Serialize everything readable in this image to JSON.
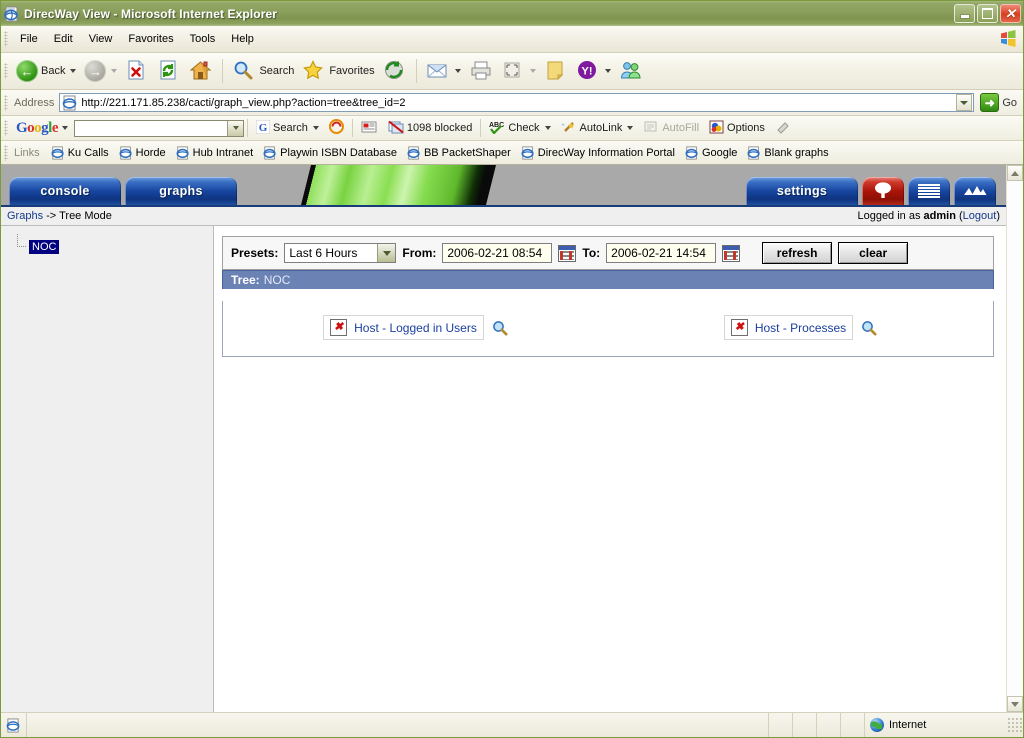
{
  "window": {
    "title": "DirecWay View - Microsoft Internet Explorer",
    "icon": "ie-document-icon",
    "minimize_label": "Minimize",
    "restore_label": "Restore",
    "close_label": "Close"
  },
  "menubar": {
    "items": [
      {
        "label": "File",
        "accel": "F"
      },
      {
        "label": "Edit",
        "accel": "E"
      },
      {
        "label": "View",
        "accel": "V"
      },
      {
        "label": "Favorites",
        "accel": "a"
      },
      {
        "label": "Tools",
        "accel": "T"
      },
      {
        "label": "Help",
        "accel": "H"
      }
    ]
  },
  "toolbar": {
    "back_label": "Back",
    "back_icon": "back-arrow-icon",
    "forward_icon": "forward-arrow-icon",
    "stop_icon": "stop-icon",
    "refresh_icon": "refresh-icon",
    "home_icon": "home-icon",
    "search_label": "Search",
    "search_icon": "magnifier-icon",
    "favorites_label": "Favorites",
    "favorites_icon": "star-icon",
    "history_icon": "history-icon",
    "mail_icon": "mail-icon",
    "print_icon": "printer-icon",
    "edit_icon": "edit-page-icon",
    "discuss_icon": "notes-icon",
    "yahoo_icon": "yahoo-icon",
    "messenger_icon": "messenger-icon"
  },
  "address": {
    "label": "Address",
    "url": "http://221.171.85.238/cacti/graph_view.php?action=tree&tree_id=2",
    "favicon": "ie-page-icon",
    "go_label": "Go",
    "go_icon": "go-arrow-icon"
  },
  "google_toolbar": {
    "brand": "Google",
    "search_value": "",
    "search_label": "Search",
    "search_icon": "google-g-icon",
    "highlight_icon": "highlight-icon",
    "news_icon": "news-icon",
    "popup_icon": "popup-blocker-icon",
    "blocked_label": "1098 blocked",
    "check_label": "Check",
    "check_icon": "spellcheck-icon",
    "autolink_label": "AutoLink",
    "autolink_icon": "autolink-wand-icon",
    "autofill_label": "AutoFill",
    "autofill_icon": "autofill-icon",
    "options_label": "Options",
    "options_icon": "options-icon",
    "eraser_icon": "eraser-icon"
  },
  "links_bar": {
    "label": "Links",
    "items": [
      {
        "label": "Ku Calls"
      },
      {
        "label": "Horde"
      },
      {
        "label": "Hub Intranet"
      },
      {
        "label": "Playwin ISBN Database"
      },
      {
        "label": "BB  PacketShaper"
      },
      {
        "label": "DirecWay Information Portal"
      },
      {
        "label": "Google"
      },
      {
        "label": "Blank graphs"
      }
    ]
  },
  "cacti": {
    "tabs": [
      {
        "label": "console",
        "name": "tab-console",
        "type": "text"
      },
      {
        "label": "graphs",
        "name": "tab-graphs",
        "type": "text"
      }
    ],
    "right_tabs": [
      {
        "label": "settings",
        "name": "tab-settings",
        "type": "text",
        "color": "#16449e"
      },
      {
        "label": "",
        "name": "tab-tree-view",
        "type": "tree-icon",
        "color": "#a81408"
      },
      {
        "label": "",
        "name": "tab-list-view",
        "type": "list-icon",
        "color": "#16449e"
      },
      {
        "label": "",
        "name": "tab-preview-view",
        "type": "preview-icon",
        "color": "#16449e"
      }
    ],
    "breadcrumb": {
      "root": "Graphs",
      "separator": "->",
      "current": "Tree Mode"
    },
    "login_prefix": "Logged in as ",
    "login_user": "admin",
    "logout_open": " (",
    "logout_label": "Logout",
    "logout_close": ")"
  },
  "tree_pane": {
    "nodes": [
      {
        "label": "NOC",
        "selected": true
      }
    ]
  },
  "filter": {
    "presets_label": "Presets:",
    "presets_value": "Last 6 Hours",
    "from_label": "From:",
    "from_value": "2006-02-21 08:54",
    "to_label": "To:",
    "to_value": "2006-02-21 14:54",
    "calendar_icon": "calendar-icon",
    "refresh_label": "refresh",
    "clear_label": "clear"
  },
  "tree_box": {
    "title_prefix": "Tree:",
    "title_name": "NOC",
    "graphs": [
      {
        "label": "Host - Logged in Users",
        "broken_icon": "broken-image-icon",
        "zoom_icon": "magnifier-icon"
      },
      {
        "label": "Host - Processes",
        "broken_icon": "broken-image-icon",
        "zoom_icon": "magnifier-icon"
      }
    ]
  },
  "statusbar": {
    "page_icon": "page-icon",
    "message": "",
    "zone_label": "Internet",
    "zone_icon": "internet-globe-icon"
  },
  "colors": {
    "title_bar": "#8b9f5d",
    "cacti_tab_blue": "#16449e",
    "cacti_tab_red": "#a81408",
    "tree_header": "#6b82b5",
    "link_blue": "#1a3f9e",
    "selection_blue": "#000080"
  }
}
